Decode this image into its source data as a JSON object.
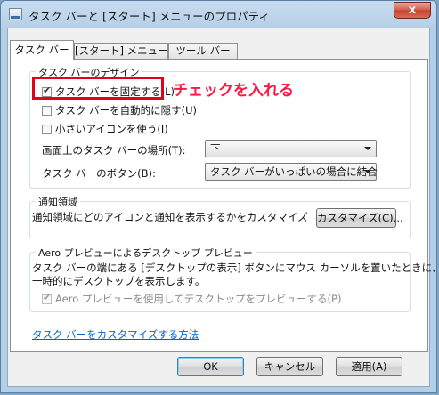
{
  "window": {
    "title": "タスク バーと [スタート] メニューのプロパティ",
    "close_label": "x"
  },
  "tabs": [
    {
      "label": "タスク バー",
      "active": true
    },
    {
      "label": "[スタート] メニュー",
      "active": false
    },
    {
      "label": "ツール バー",
      "active": false
    }
  ],
  "design_group": {
    "legend": "タスク バーのデザイン",
    "checkboxes": [
      {
        "label": "タスク バーを固定する(L)",
        "checked": true
      },
      {
        "label": "タスク バーを自動的に隠す(U)",
        "checked": false
      },
      {
        "label": "小さいアイコンを使う(I)",
        "checked": false
      }
    ],
    "location_label": "画面上のタスク バーの場所(T):",
    "location_value": "下",
    "buttons_label": "タスク バーのボタン(B):",
    "buttons_value": "タスク バーがいっぱいの場合に結合"
  },
  "notify_group": {
    "legend": "通知領域",
    "description": "通知領域にどのアイコンと通知を表示するかをカスタマイズします。",
    "customize_button": "カスタマイズ(C)..."
  },
  "aero_group": {
    "legend": "Aero プレビューによるデスクトップ プレビュー",
    "description_line1": "タスク バーの端にある [デスクトップの表示] ボタンにマウス カーソルを置いたときに、",
    "description_line2": "一時的にデスクトップを表示します。",
    "checkbox_label": "Aero プレビューを使用してデスクトップをプレビューする(P)",
    "checkbox_checked": true,
    "checkbox_disabled": true
  },
  "help_link": "タスク バーをカスタマイズする方法",
  "footer": {
    "ok": "OK",
    "cancel": "キャンセル",
    "apply": "適用(A)"
  },
  "annotation": {
    "text": "チェックを入れる",
    "color": "#ff1744"
  }
}
